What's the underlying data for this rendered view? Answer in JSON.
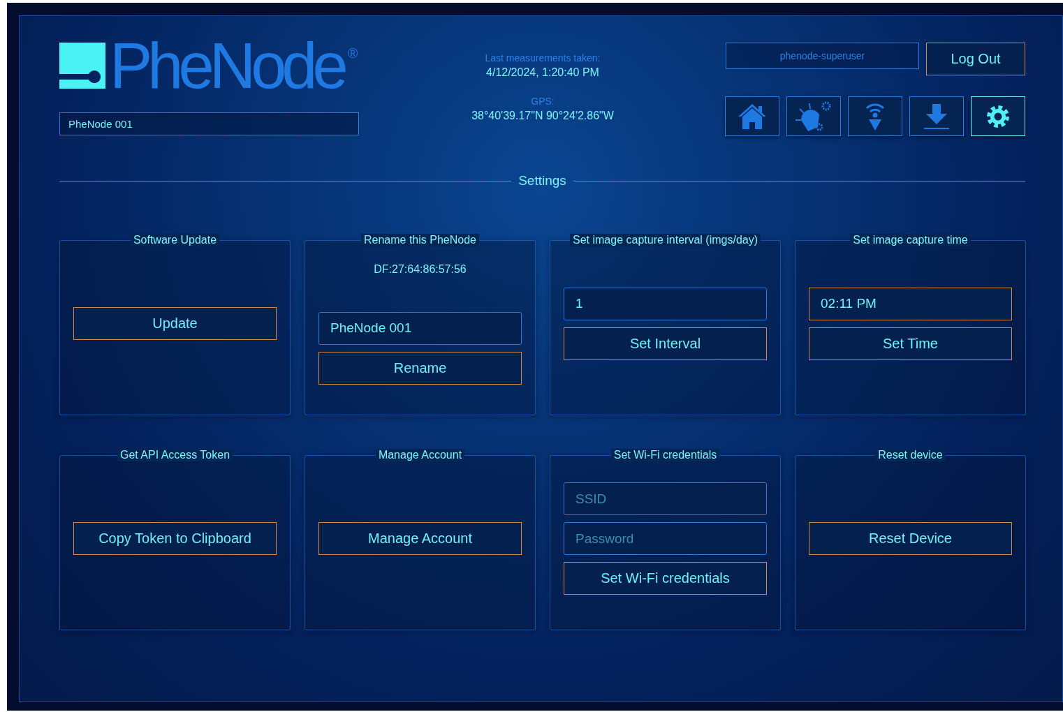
{
  "logo": {
    "text": "PheNode",
    "mark": "®"
  },
  "device_name_field": {
    "value": "PheNode 001"
  },
  "measurements": [
    {
      "label": "Last measurements taken:",
      "value": "4/12/2024, 1:20:40 PM"
    },
    {
      "label": "GPS:",
      "value": "38°40'39.17\"N 90°24'2.86\"W"
    }
  ],
  "user": {
    "name": "phenode-superuser",
    "logout": "Log Out"
  },
  "nav": [
    {
      "kind": "home",
      "selected": false
    },
    {
      "kind": "plant-settings",
      "selected": false
    },
    {
      "kind": "wifi",
      "selected": false
    },
    {
      "kind": "download",
      "selected": false
    },
    {
      "kind": "settings",
      "selected": true
    }
  ],
  "section_title": "Settings",
  "cards": [
    {
      "title": "Software Update",
      "items": [
        {
          "kind": "button",
          "label": "Update"
        }
      ]
    },
    {
      "title": "Rename this PheNode",
      "items": [
        {
          "kind": "text",
          "text": "DF:27:64:86:57:56"
        },
        {
          "kind": "field",
          "value": "PheNode 001"
        },
        {
          "kind": "button",
          "label": "Rename"
        }
      ]
    },
    {
      "title": "Set image capture interval (imgs/day)",
      "items": [
        {
          "kind": "field",
          "value": "1"
        },
        {
          "kind": "button",
          "label": "Set Interval"
        }
      ]
    },
    {
      "title": "Set image capture time",
      "items": [
        {
          "kind": "time-field",
          "value": "02:11 PM"
        },
        {
          "kind": "button",
          "label": "Set Time"
        }
      ]
    },
    {
      "title": "Get API Access Token",
      "items": [
        {
          "kind": "button",
          "label": "Copy Token to Clipboard"
        }
      ]
    },
    {
      "title": "Manage Account",
      "items": [
        {
          "kind": "button",
          "label": "Manage Account"
        }
      ]
    },
    {
      "title": "Set Wi-Fi credentials",
      "items": [
        {
          "kind": "field",
          "placeholder": "SSID"
        },
        {
          "kind": "field",
          "placeholder": "Password"
        },
        {
          "kind": "button",
          "label": "Set Wi-Fi credentials"
        }
      ]
    },
    {
      "title": "Reset device",
      "items": [
        {
          "kind": "button",
          "label": "Reset Device"
        }
      ]
    }
  ]
}
